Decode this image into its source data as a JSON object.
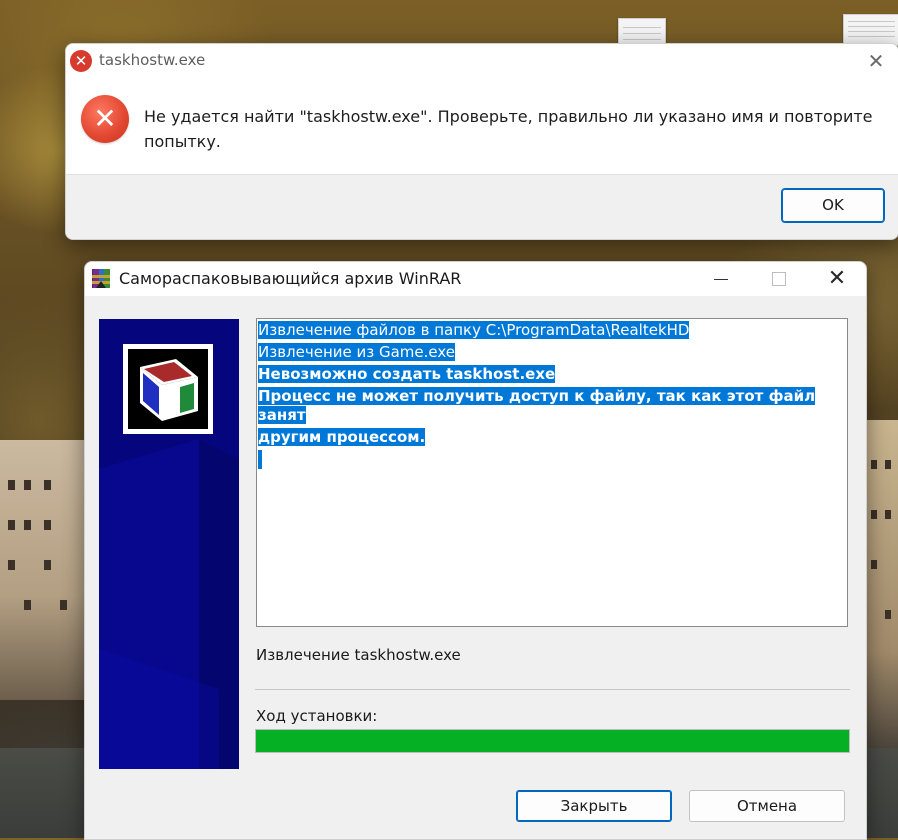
{
  "message_box": {
    "title": "taskhostw.exe",
    "message": "Не удается найти \"taskhostw.exe\". Проверьте, правильно ли указано имя и повторите попытку.",
    "ok_label": "OK",
    "close_glyph": "✕",
    "icon": "error-icon"
  },
  "sfx_window": {
    "title": "Самораспаковывающийся архив WinRAR",
    "log_lines": [
      {
        "text": "Извлечение файлов в папку C:\\ProgramData\\RealtekHD",
        "bold": false
      },
      {
        "text": "Извлечение из Game.exe",
        "bold": false
      },
      {
        "text": "Невозможно создать taskhost.exe",
        "bold": true
      },
      {
        "text": "Процесс не может получить доступ к файлу, так как этот файл занят",
        "bold": true
      },
      {
        "text": "другим процессом.",
        "bold": true
      }
    ],
    "status_text": "Извлечение taskhostw.exe",
    "progress_label": "Ход установки:",
    "progress_fraction": 1.0,
    "close_button": "Закрыть",
    "cancel_button": "Отмена",
    "window_controls": {
      "minimize": "minimize-icon",
      "maximize": "maximize-icon",
      "close": "✕"
    },
    "colors": {
      "progress": "#06b025",
      "banner": "#05067e",
      "selection": "#0078d7"
    }
  }
}
